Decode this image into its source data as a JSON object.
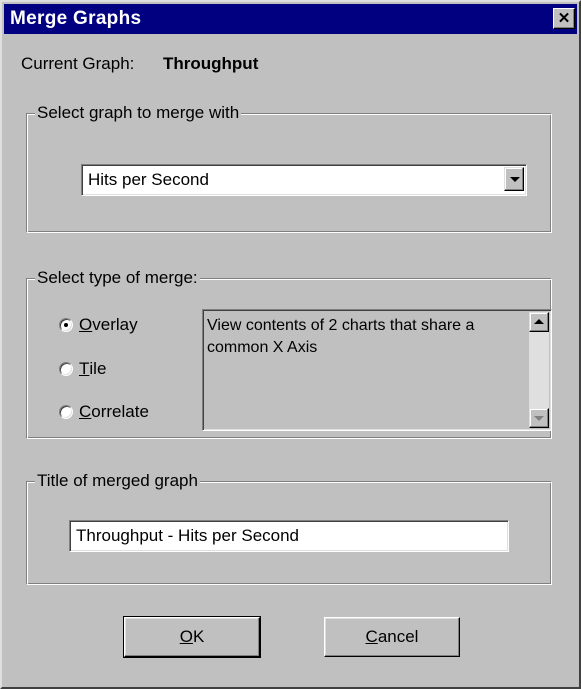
{
  "window": {
    "title": "Merge Graphs",
    "close_glyph": "✕"
  },
  "current_graph": {
    "label": "Current Graph:",
    "value": "Throughput"
  },
  "merge_with": {
    "legend": "Select graph to merge with",
    "selected": "Hits per Second"
  },
  "merge_type": {
    "legend": "Select type of merge:",
    "options": [
      {
        "mnemonic": "O",
        "rest": "verlay",
        "selected": true
      },
      {
        "mnemonic": "T",
        "rest": "ile",
        "selected": false
      },
      {
        "mnemonic": "C",
        "rest": "orrelate",
        "selected": false
      }
    ],
    "description": "View contents of 2 charts that share a common X Axis"
  },
  "merged_title": {
    "legend": "Title of merged graph",
    "value": "Throughput - Hits per Second"
  },
  "buttons": {
    "ok": {
      "mnemonic": "O",
      "rest": "K"
    },
    "cancel": {
      "mnemonic": "C",
      "rest": "ancel"
    }
  },
  "icons": {
    "close": "close-icon",
    "dropdown": "chevron-down-icon",
    "scroll_up": "scroll-up-icon",
    "scroll_down": "scroll-down-icon"
  }
}
